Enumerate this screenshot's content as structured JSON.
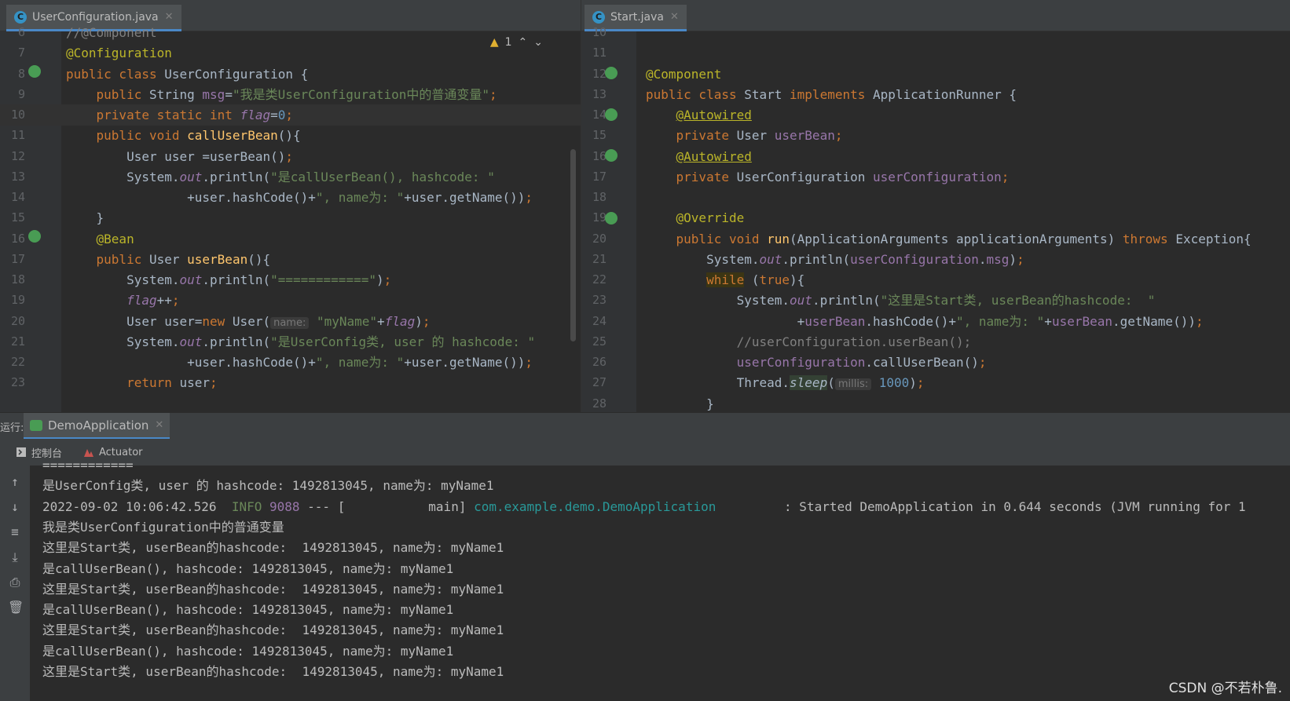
{
  "left_editor": {
    "tab_label": "UserConfiguration.java",
    "warning_count": "1",
    "lines": [
      {
        "n": "6",
        "parts": [
          {
            "t": "//@Component",
            "c": "cmt"
          }
        ]
      },
      {
        "n": "7",
        "parts": [
          {
            "t": "@Configuration",
            "c": "ann"
          }
        ]
      },
      {
        "n": "8",
        "parts": [
          {
            "t": "public class ",
            "c": "kw"
          },
          {
            "t": "UserConfiguration {",
            "c": ""
          }
        ]
      },
      {
        "n": "9",
        "parts": [
          {
            "t": "    public ",
            "c": "kw"
          },
          {
            "t": "String ",
            "c": ""
          },
          {
            "t": "msg",
            "c": "fld"
          },
          {
            "t": "=",
            "c": ""
          },
          {
            "t": "\"我是类UserConfiguration中的普通变量\"",
            "c": "str"
          },
          {
            "t": ";",
            "c": "kw"
          }
        ]
      },
      {
        "n": "10",
        "parts": [
          {
            "t": "    private static int ",
            "c": "kw"
          },
          {
            "t": "flag",
            "c": "fld ital"
          },
          {
            "t": "=",
            "c": ""
          },
          {
            "t": "0",
            "c": "num"
          },
          {
            "t": ";",
            "c": "kw"
          }
        ]
      },
      {
        "n": "11",
        "parts": [
          {
            "t": "    public void ",
            "c": "kw"
          },
          {
            "t": "callUserBean",
            "c": "fn"
          },
          {
            "t": "(){",
            "c": ""
          }
        ]
      },
      {
        "n": "12",
        "parts": [
          {
            "t": "        User user =userBean()",
            "c": ""
          },
          {
            "t": ";",
            "c": "kw"
          }
        ]
      },
      {
        "n": "13",
        "parts": [
          {
            "t": "        System.",
            "c": ""
          },
          {
            "t": "out",
            "c": "fld ital"
          },
          {
            "t": ".println(",
            "c": ""
          },
          {
            "t": "\"是callUserBean(), hashcode: \"",
            "c": "str"
          }
        ]
      },
      {
        "n": "14",
        "parts": [
          {
            "t": "                +user.hashCode()+",
            "c": ""
          },
          {
            "t": "\", name为: \"",
            "c": "str"
          },
          {
            "t": "+user.getName())",
            "c": ""
          },
          {
            "t": ";",
            "c": "kw"
          }
        ]
      },
      {
        "n": "15",
        "parts": [
          {
            "t": "    }",
            "c": ""
          }
        ]
      },
      {
        "n": "16",
        "parts": [
          {
            "t": "    @Bean",
            "c": "ann"
          }
        ]
      },
      {
        "n": "17",
        "parts": [
          {
            "t": "    public ",
            "c": "kw"
          },
          {
            "t": "User ",
            "c": ""
          },
          {
            "t": "userBean",
            "c": "fn"
          },
          {
            "t": "(){",
            "c": ""
          }
        ]
      },
      {
        "n": "18",
        "parts": [
          {
            "t": "        System.",
            "c": ""
          },
          {
            "t": "out",
            "c": "fld ital"
          },
          {
            "t": ".println(",
            "c": ""
          },
          {
            "t": "\"============\"",
            "c": "str"
          },
          {
            "t": ")",
            "c": ""
          },
          {
            "t": ";",
            "c": "kw"
          }
        ]
      },
      {
        "n": "19",
        "parts": [
          {
            "t": "        ",
            "c": ""
          },
          {
            "t": "flag",
            "c": "fld ital"
          },
          {
            "t": "++",
            "c": ""
          },
          {
            "t": ";",
            "c": "kw"
          }
        ]
      },
      {
        "n": "20",
        "parts": [
          {
            "t": "        User user=",
            "c": ""
          },
          {
            "t": "new ",
            "c": "kw"
          },
          {
            "t": "User(",
            "c": ""
          },
          {
            "t": "name:",
            "c": "hint"
          },
          {
            "t": " ",
            "c": ""
          },
          {
            "t": "\"myName\"",
            "c": "str"
          },
          {
            "t": "+",
            "c": ""
          },
          {
            "t": "flag",
            "c": "fld ital"
          },
          {
            "t": ")",
            "c": ""
          },
          {
            "t": ";",
            "c": "kw"
          }
        ]
      },
      {
        "n": "21",
        "parts": [
          {
            "t": "        System.",
            "c": ""
          },
          {
            "t": "out",
            "c": "fld ital"
          },
          {
            "t": ".println(",
            "c": ""
          },
          {
            "t": "\"是UserConfig类, user 的 hashcode: \"",
            "c": "str"
          }
        ]
      },
      {
        "n": "22",
        "parts": [
          {
            "t": "                +user.hashCode()+",
            "c": ""
          },
          {
            "t": "\", name为: \"",
            "c": "str"
          },
          {
            "t": "+user.getName())",
            "c": ""
          },
          {
            "t": ";",
            "c": "kw"
          }
        ]
      },
      {
        "n": "23",
        "parts": [
          {
            "t": "        ",
            "c": ""
          },
          {
            "t": "return ",
            "c": "kw"
          },
          {
            "t": "user",
            "c": ""
          },
          {
            "t": ";",
            "c": "kw"
          }
        ]
      }
    ]
  },
  "right_editor": {
    "tab_label": "Start.java",
    "lines": [
      {
        "n": "10",
        "parts": []
      },
      {
        "n": "11",
        "parts": []
      },
      {
        "n": "12",
        "parts": [
          {
            "t": "@Component",
            "c": "ann"
          }
        ]
      },
      {
        "n": "13",
        "parts": [
          {
            "t": "public class ",
            "c": "kw"
          },
          {
            "t": "Start ",
            "c": ""
          },
          {
            "t": "implements ",
            "c": "kw"
          },
          {
            "t": "ApplicationRunner {",
            "c": ""
          }
        ]
      },
      {
        "n": "14",
        "parts": [
          {
            "t": "    ",
            "c": ""
          },
          {
            "t": "@Autowired",
            "c": "ann uline"
          }
        ]
      },
      {
        "n": "15",
        "parts": [
          {
            "t": "    private ",
            "c": "kw"
          },
          {
            "t": "User ",
            "c": ""
          },
          {
            "t": "userBean",
            "c": "fld"
          },
          {
            "t": ";",
            "c": "kw"
          }
        ]
      },
      {
        "n": "16",
        "parts": [
          {
            "t": "    ",
            "c": ""
          },
          {
            "t": "@Autowired",
            "c": "ann uline"
          }
        ]
      },
      {
        "n": "17",
        "parts": [
          {
            "t": "    private ",
            "c": "kw"
          },
          {
            "t": "UserConfiguration ",
            "c": ""
          },
          {
            "t": "userConfiguration",
            "c": "fld"
          },
          {
            "t": ";",
            "c": "kw"
          }
        ]
      },
      {
        "n": "18",
        "parts": []
      },
      {
        "n": "19",
        "parts": [
          {
            "t": "    @Override",
            "c": "ann"
          }
        ]
      },
      {
        "n": "20",
        "parts": [
          {
            "t": "    public void ",
            "c": "kw"
          },
          {
            "t": "run",
            "c": "fn"
          },
          {
            "t": "(ApplicationArguments applicationArguments) ",
            "c": ""
          },
          {
            "t": "throws ",
            "c": "kw"
          },
          {
            "t": "Exception{",
            "c": ""
          }
        ]
      },
      {
        "n": "21",
        "parts": [
          {
            "t": "        System.",
            "c": ""
          },
          {
            "t": "out",
            "c": "fld ital"
          },
          {
            "t": ".println(",
            "c": ""
          },
          {
            "t": "userConfiguration",
            "c": "fld"
          },
          {
            "t": ".",
            "c": ""
          },
          {
            "t": "msg",
            "c": "fld"
          },
          {
            "t": ")",
            "c": ""
          },
          {
            "t": ";",
            "c": "kw"
          }
        ]
      },
      {
        "n": "22",
        "parts": [
          {
            "t": "        ",
            "c": ""
          },
          {
            "t": "while",
            "c": "kw whilebg"
          },
          {
            "t": " (",
            "c": ""
          },
          {
            "t": "true",
            "c": "kw"
          },
          {
            "t": "){",
            "c": ""
          }
        ]
      },
      {
        "n": "23",
        "parts": [
          {
            "t": "            System.",
            "c": ""
          },
          {
            "t": "out",
            "c": "fld ital"
          },
          {
            "t": ".println(",
            "c": ""
          },
          {
            "t": "\"这里是Start类, userBean的hashcode:  \"",
            "c": "str"
          }
        ]
      },
      {
        "n": "24",
        "parts": [
          {
            "t": "                    +",
            "c": ""
          },
          {
            "t": "userBean",
            "c": "fld"
          },
          {
            "t": ".hashCode()+",
            "c": ""
          },
          {
            "t": "\", name为: \"",
            "c": "str"
          },
          {
            "t": "+",
            "c": ""
          },
          {
            "t": "userBean",
            "c": "fld"
          },
          {
            "t": ".getName())",
            "c": ""
          },
          {
            "t": ";",
            "c": "kw"
          }
        ]
      },
      {
        "n": "25",
        "parts": [
          {
            "t": "            //userConfiguration.userBean();",
            "c": "cmt"
          }
        ]
      },
      {
        "n": "26",
        "parts": [
          {
            "t": "            ",
            "c": ""
          },
          {
            "t": "userConfiguration",
            "c": "fld"
          },
          {
            "t": ".callUserBean()",
            "c": ""
          },
          {
            "t": ";",
            "c": "kw"
          }
        ]
      },
      {
        "n": "27",
        "parts": [
          {
            "t": "            Thread.",
            "c": ""
          },
          {
            "t": "sleep",
            "c": "ital sleepbg"
          },
          {
            "t": "(",
            "c": ""
          },
          {
            "t": "millis:",
            "c": "hint"
          },
          {
            "t": " ",
            "c": ""
          },
          {
            "t": "1000",
            "c": "num"
          },
          {
            "t": ")",
            "c": ""
          },
          {
            "t": ";",
            "c": "kw"
          }
        ]
      },
      {
        "n": "28",
        "parts": [
          {
            "t": "        }",
            "c": ""
          }
        ]
      }
    ]
  },
  "run_panel": {
    "label": "运行:",
    "run_tab": "DemoApplication",
    "console_tab": "控制台",
    "actuator_tab": "Actuator"
  },
  "console_lines": [
    {
      "parts": [
        {
          "t": "============",
          "c": ""
        }
      ]
    },
    {
      "parts": [
        {
          "t": "是UserConfig类, user 的 hashcode: 1492813045, name为: myName1",
          "c": ""
        }
      ]
    },
    {
      "parts": [
        {
          "t": "2022-09-02 10:06:42.526  ",
          "c": ""
        },
        {
          "t": "INFO",
          "c": "cinfo"
        },
        {
          "t": " ",
          "c": ""
        },
        {
          "t": "9088",
          "c": "cnum"
        },
        {
          "t": " --- [           main] ",
          "c": ""
        },
        {
          "t": "com.example.demo.DemoApplication",
          "c": "clog"
        },
        {
          "t": "         : Started DemoApplication in 0.644 seconds (JVM running for 1",
          "c": ""
        }
      ]
    },
    {
      "parts": [
        {
          "t": "我是类UserConfiguration中的普通变量",
          "c": ""
        }
      ]
    },
    {
      "parts": [
        {
          "t": "这里是Start类, userBean的hashcode:  1492813045, name为: myName1",
          "c": ""
        }
      ]
    },
    {
      "parts": [
        {
          "t": "是callUserBean(), hashcode: 1492813045, name为: myName1",
          "c": ""
        }
      ]
    },
    {
      "parts": [
        {
          "t": "这里是Start类, userBean的hashcode:  1492813045, name为: myName1",
          "c": ""
        }
      ]
    },
    {
      "parts": [
        {
          "t": "是callUserBean(), hashcode: 1492813045, name为: myName1",
          "c": ""
        }
      ]
    },
    {
      "parts": [
        {
          "t": "这里是Start类, userBean的hashcode:  1492813045, name为: myName1",
          "c": ""
        }
      ]
    },
    {
      "parts": [
        {
          "t": "是callUserBean(), hashcode: 1492813045, name为: myName1",
          "c": ""
        }
      ]
    },
    {
      "parts": [
        {
          "t": "这里是Start类, userBean的hashcode:  1492813045, name为: myName1",
          "c": ""
        }
      ]
    }
  ],
  "watermark": "CSDN @不若朴鲁.",
  "colors": {
    "keyword": "#cc7832",
    "annotation": "#bbb529",
    "string": "#6a8759",
    "field": "#9876aa",
    "method": "#ffc66d",
    "number": "#6897bb",
    "background": "#2b2b2b"
  }
}
